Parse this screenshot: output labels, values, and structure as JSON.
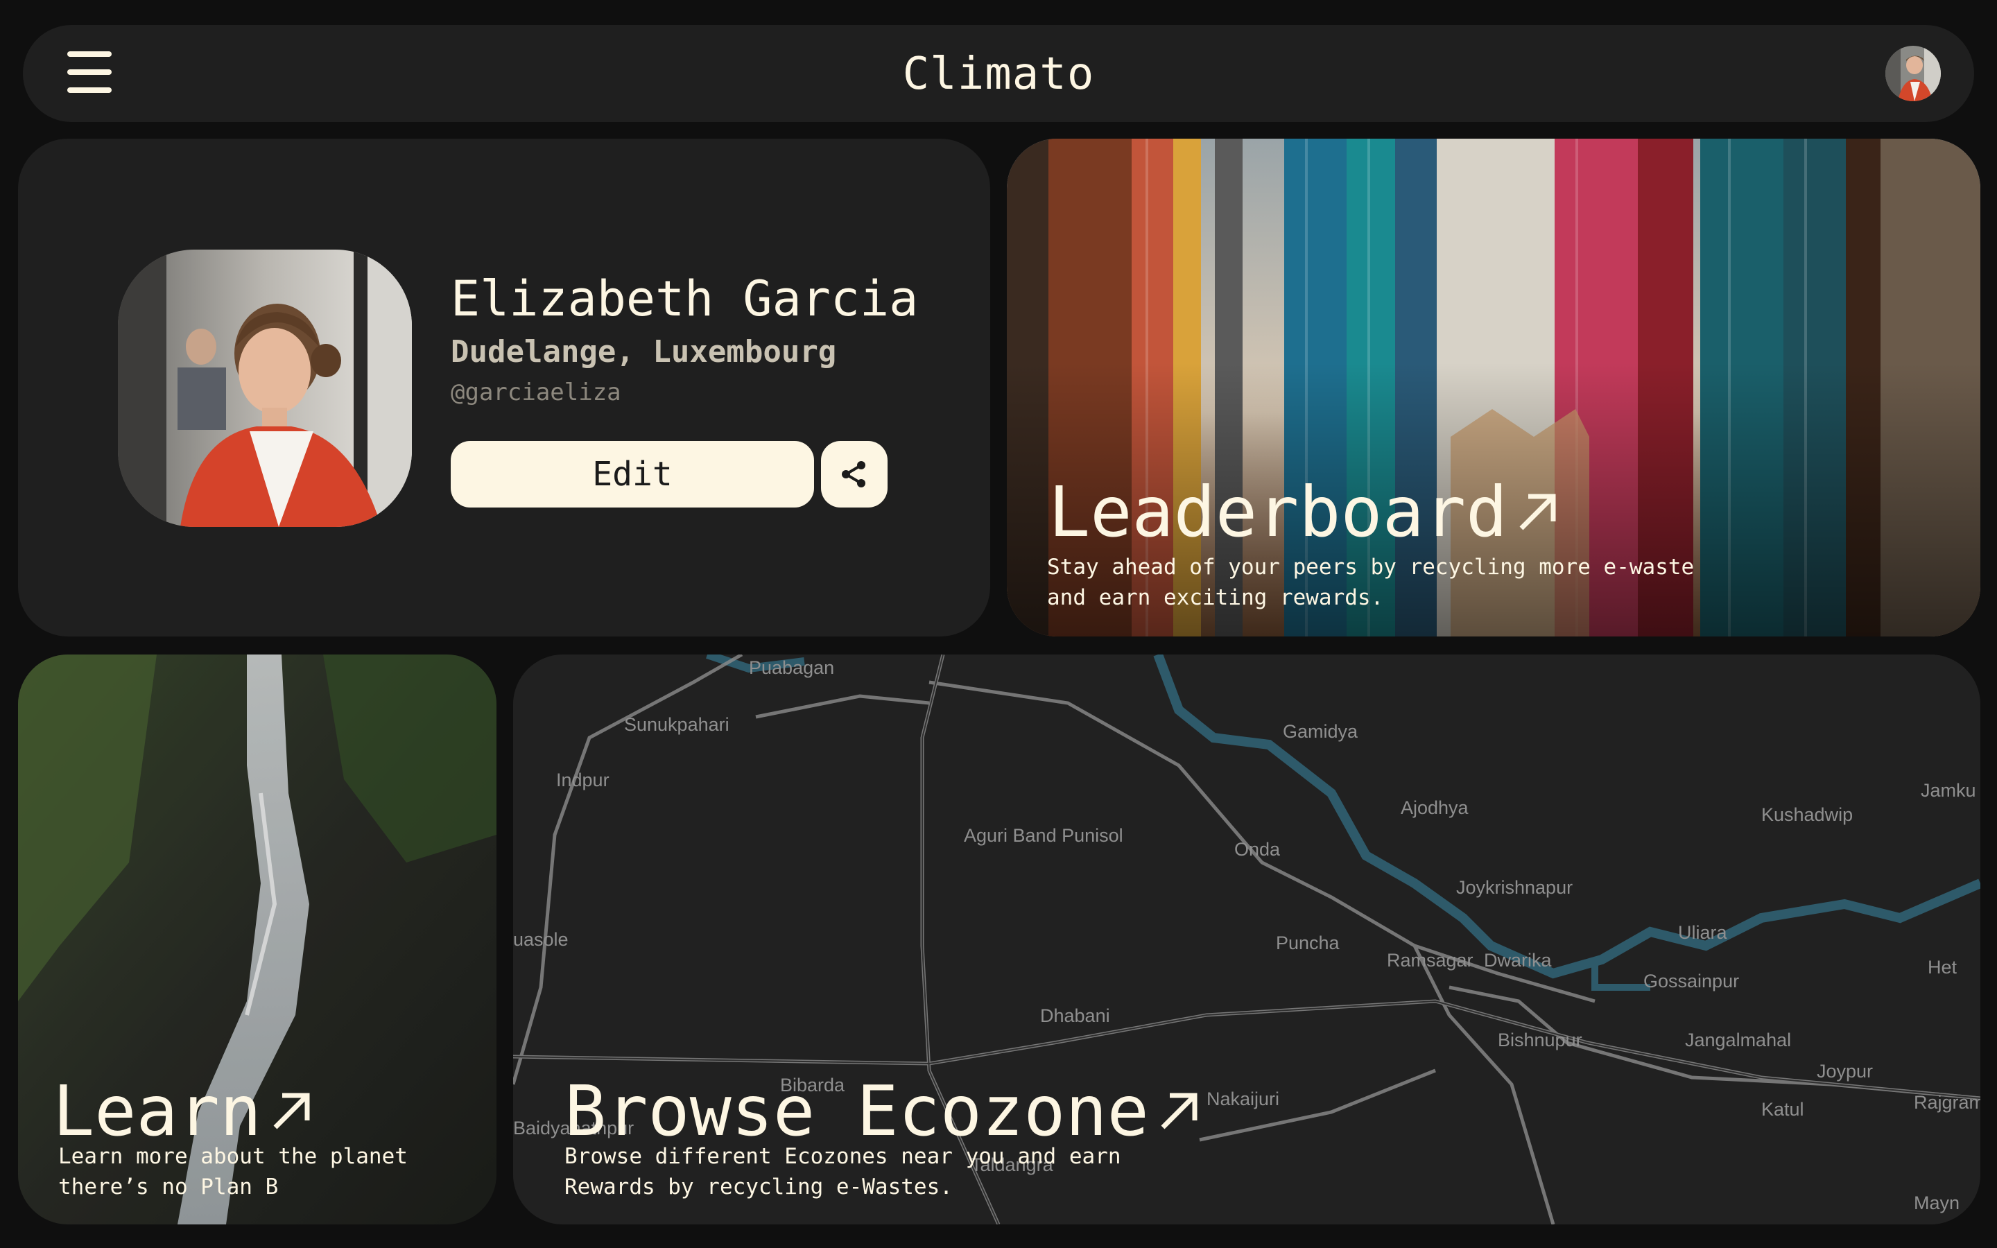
{
  "app": {
    "title": "Climato"
  },
  "header": {
    "menu_icon": "hamburger-menu-icon",
    "avatar_icon": "user-avatar"
  },
  "profile": {
    "name": "Elizabeth Garcia",
    "location": "Dudelange, Luxembourg",
    "handle": "@garciaeliza",
    "edit_label": "Edit",
    "share_icon": "share-icon"
  },
  "leaderboard": {
    "title": "Leaderboard",
    "subtitle": "Stay ahead of your peers by recycling more e-waste\nand earn exciting rewards."
  },
  "learn": {
    "title": "Learn",
    "subtitle": "Learn more about the planet\nthere’s no Plan B"
  },
  "ecozone": {
    "title": "Browse Ecozone",
    "subtitle": "Browse different Ecozones near you and earn\nRewards by recycling e-Wastes.",
    "map_places": [
      "Puabagan",
      "Sunukpahari",
      "Indpur",
      "Gamidya",
      "Ajodhya",
      "Kushadwip",
      "Jamku",
      "Aguri Band Punisol",
      "Onda",
      "Joykrishnapur",
      "Uliara",
      "Puncha",
      "Ramsagar",
      "Dwarika",
      "Gossainpur",
      "Het",
      "uasole",
      "Dhabani",
      "Bishnupur",
      "Jangalmahal",
      "Joypur",
      "Bibarda",
      "Nakaijuri",
      "Katul",
      "Rajgram",
      "Baidyanathpur",
      "Taldangra",
      "Mayn"
    ]
  },
  "colors": {
    "background": "#0f0f0f",
    "card": "#1f1f1f",
    "cream": "#fdf6e3",
    "river": "#2e5a6a"
  }
}
